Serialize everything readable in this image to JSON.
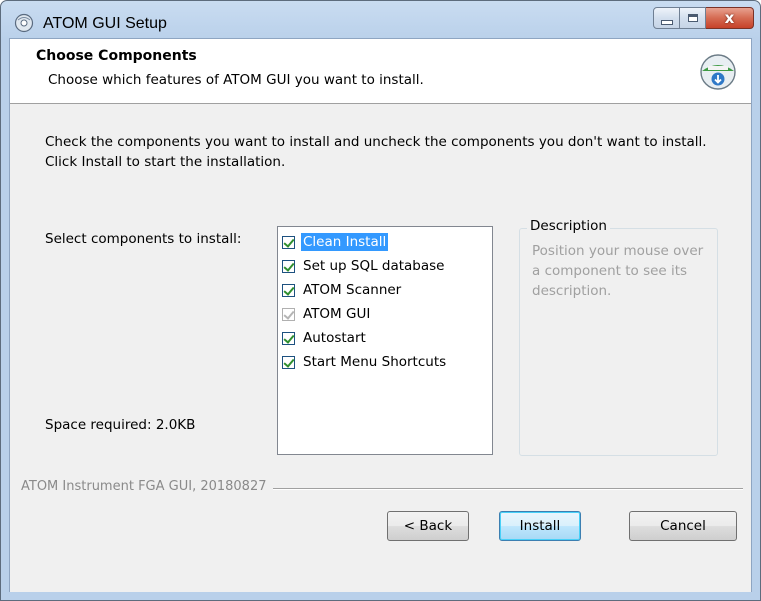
{
  "window": {
    "title": "ATOM GUI Setup",
    "close_glyph": "x"
  },
  "header": {
    "title": "Choose Components",
    "subtitle": "Choose which features of ATOM GUI you want to install.",
    "icon": "installer-disc-icon"
  },
  "body": {
    "intro": "Check the components you want to install and uncheck the components you don't want to install. Click Install to start the installation.",
    "select_label": "Select components to install:",
    "space_required": "Space required: 2.0KB"
  },
  "components": [
    {
      "label": "Clean Install",
      "checked": true,
      "enabled": true,
      "selected": true
    },
    {
      "label": "Set up SQL database",
      "checked": true,
      "enabled": true,
      "selected": false
    },
    {
      "label": "ATOM Scanner",
      "checked": true,
      "enabled": true,
      "selected": false
    },
    {
      "label": "ATOM GUI",
      "checked": true,
      "enabled": false,
      "selected": false
    },
    {
      "label": "Autostart",
      "checked": true,
      "enabled": true,
      "selected": false
    },
    {
      "label": "Start Menu Shortcuts",
      "checked": true,
      "enabled": true,
      "selected": false
    }
  ],
  "description": {
    "title": "Description",
    "text": "Position your mouse over a component to see its description."
  },
  "footer": {
    "brand": "ATOM Instrument FGA GUI, 20180827",
    "back_label": "< Back",
    "install_label": "Install",
    "cancel_label": "Cancel"
  },
  "colors": {
    "selection": "#3399ff",
    "checkmark": "#2f8f2f",
    "close_button": "#c7422a"
  }
}
